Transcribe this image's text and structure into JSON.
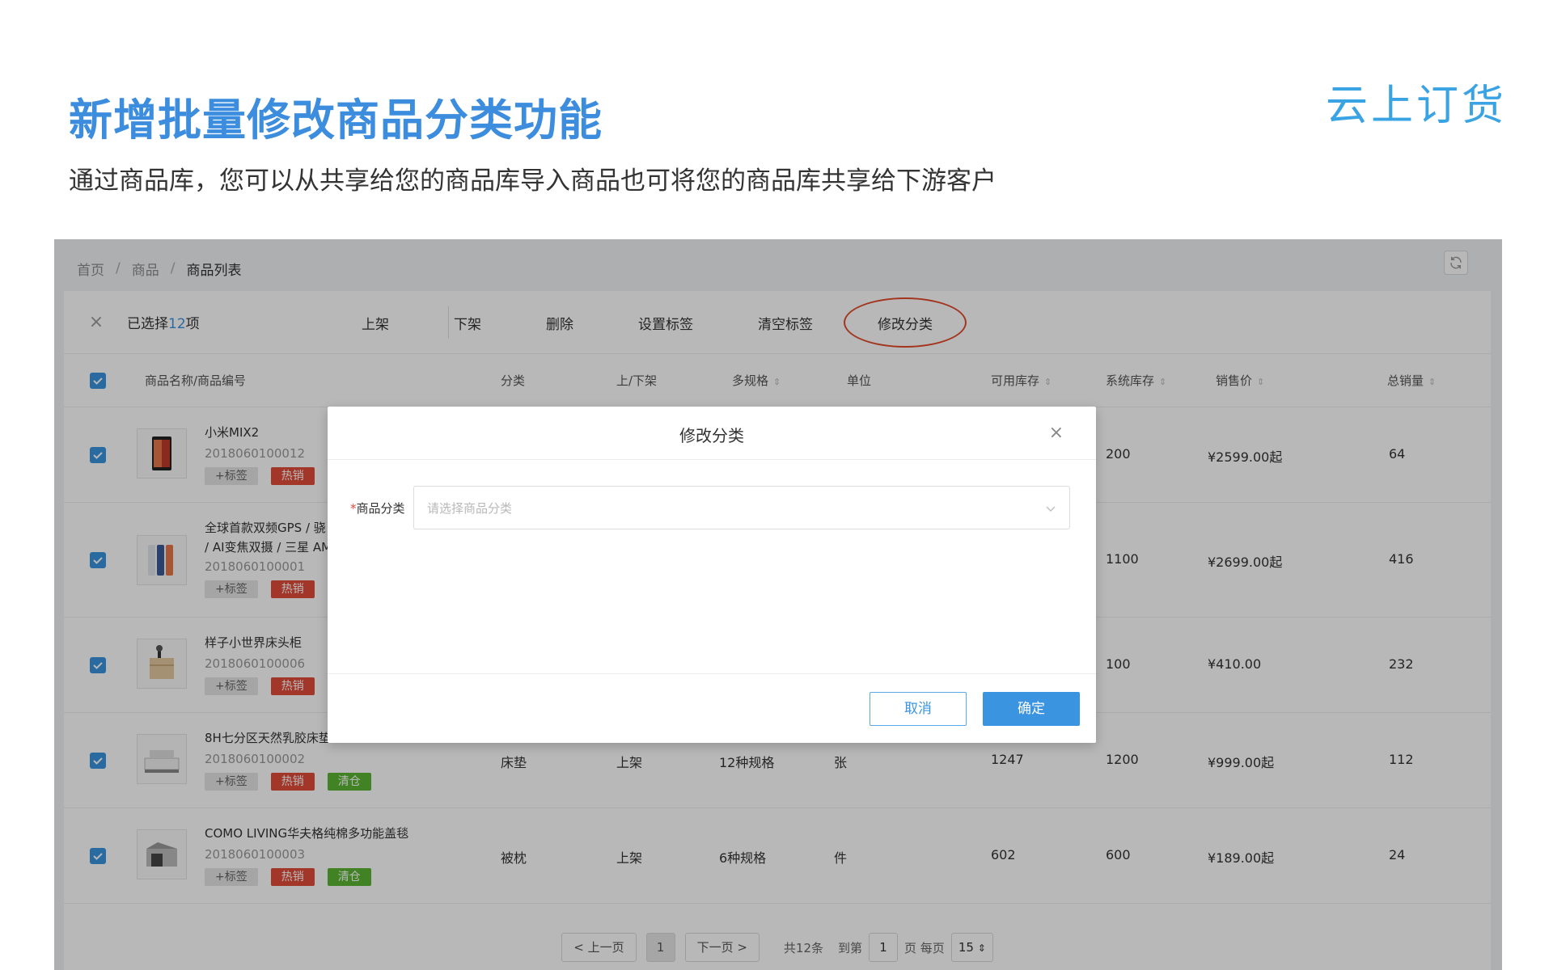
{
  "slide": {
    "headline": "新增批量修改商品分类功能",
    "subhead": "通过商品库，您可以从共享给您的商品库导入商品也可将您的商品库共享给下游客户",
    "logo_text": "云上订货"
  },
  "breadcrumb": {
    "home": "首页",
    "sep": "/",
    "products": "商品",
    "current": "商品列表"
  },
  "bulkbar": {
    "selected_prefix": "已选择",
    "selected_count": "12",
    "selected_suffix": "项",
    "actions": [
      "上架",
      "下架",
      "删除",
      "设置标签",
      "清空标签",
      "修改分类"
    ],
    "highlighted_action": "修改分类",
    "highlight_color": "#e24a2a"
  },
  "table": {
    "headers": {
      "name": "商品名称/商品编号",
      "category": "分类",
      "status": "上/下架",
      "specs": "多规格",
      "unit": "单位",
      "available_stock": "可用库存",
      "system_stock": "系统库存",
      "price": "销售价",
      "total_sales": "总销量"
    },
    "tags": {
      "add": "+标签",
      "hot": "热销",
      "clearance": "清仓"
    },
    "rows": [
      {
        "name": "小米MIX2",
        "name2": "",
        "code": "2018060100012",
        "category": "",
        "status": "",
        "specs": "",
        "unit": "",
        "available": "",
        "system": "200",
        "price": "¥2599.00起",
        "sales": "64",
        "tags": [
          "add",
          "hot"
        ]
      },
      {
        "name": "全球首款双频GPS / 骁",
        "name2": "/ AI变焦双摄 / 三星 AM",
        "code": "2018060100001",
        "category": "",
        "status": "",
        "specs": "",
        "unit": "",
        "available": "",
        "system": "1100",
        "price": "¥2699.00起",
        "sales": "416",
        "tags": [
          "add",
          "hot"
        ]
      },
      {
        "name": "样子小世界床头柜",
        "name2": "",
        "code": "2018060100006",
        "category": "",
        "status": "",
        "specs": "",
        "unit": "",
        "available": "",
        "system": "100",
        "price": "¥410.00",
        "sales": "232",
        "tags": [
          "add",
          "hot"
        ]
      },
      {
        "name": "8H七分区天然乳胶床垫",
        "name2": "",
        "code": "2018060100002",
        "category": "床垫",
        "status": "上架",
        "specs": "12种规格",
        "unit": "张",
        "available": "1247",
        "system": "1200",
        "price": "¥999.00起",
        "sales": "112",
        "tags": [
          "add",
          "hot",
          "clearance"
        ]
      },
      {
        "name": "COMO LIVING华夫格纯棉多功能盖毯",
        "name2": "",
        "code": "2018060100003",
        "category": "被枕",
        "status": "上架",
        "specs": "6种规格",
        "unit": "件",
        "available": "602",
        "system": "600",
        "price": "¥189.00起",
        "sales": "24",
        "tags": [
          "add",
          "hot",
          "clearance"
        ]
      }
    ]
  },
  "pager": {
    "prev": "< 上一页",
    "current_page": "1",
    "next": "下一页 >",
    "total": "共12条",
    "goto_prefix": "到第",
    "goto_value": "1",
    "goto_suffix": "页 每页",
    "page_size": "15"
  },
  "modal": {
    "title": "修改分类",
    "close": "×",
    "field_required_mark": "*",
    "field_label": "商品分类",
    "select_placeholder": "请选择商品分类",
    "cancel": "取消",
    "confirm": "确定"
  },
  "colors": {
    "accent": "#3a94e0",
    "headline": "#3c8dde",
    "hot_tag": "#e04c3a",
    "clearance_tag": "#5ab532"
  }
}
